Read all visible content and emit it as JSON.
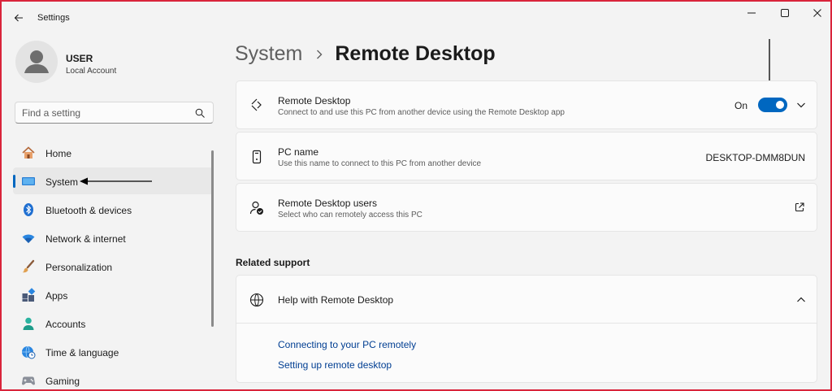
{
  "window": {
    "title": "Settings"
  },
  "user": {
    "name": "USER",
    "account_type": "Local Account"
  },
  "search": {
    "placeholder": "Find a setting"
  },
  "sidebar": {
    "items": [
      {
        "label": "Home",
        "icon": "home-icon",
        "active": false
      },
      {
        "label": "System",
        "icon": "monitor-icon",
        "active": true
      },
      {
        "label": "Bluetooth & devices",
        "icon": "bluetooth-icon",
        "active": false
      },
      {
        "label": "Network & internet",
        "icon": "wifi-icon",
        "active": false
      },
      {
        "label": "Personalization",
        "icon": "brush-icon",
        "active": false
      },
      {
        "label": "Apps",
        "icon": "apps-icon",
        "active": false
      },
      {
        "label": "Accounts",
        "icon": "person-icon",
        "active": false
      },
      {
        "label": "Time & language",
        "icon": "globe-clock-icon",
        "active": false
      },
      {
        "label": "Gaming",
        "icon": "gamepad-icon",
        "active": false
      }
    ]
  },
  "breadcrumb": {
    "parent": "System",
    "current": "Remote Desktop"
  },
  "cards": {
    "remote_desktop": {
      "title": "Remote Desktop",
      "description": "Connect to and use this PC from another device using the Remote Desktop app",
      "toggle_label": "On",
      "toggle_on": true
    },
    "pc_name": {
      "title": "PC name",
      "description": "Use this name to connect to this PC from another device",
      "value": "DESKTOP-DMM8DUN"
    },
    "remote_users": {
      "title": "Remote Desktop users",
      "description": "Select who can remotely access this PC"
    }
  },
  "related_support": {
    "section_title": "Related support",
    "help_title": "Help with Remote Desktop",
    "links": [
      "Connecting to your PC remotely",
      "Setting up remote desktop"
    ]
  },
  "colors": {
    "accent": "#0067c0",
    "link": "#003e92",
    "frame_border": "#d9243b"
  }
}
